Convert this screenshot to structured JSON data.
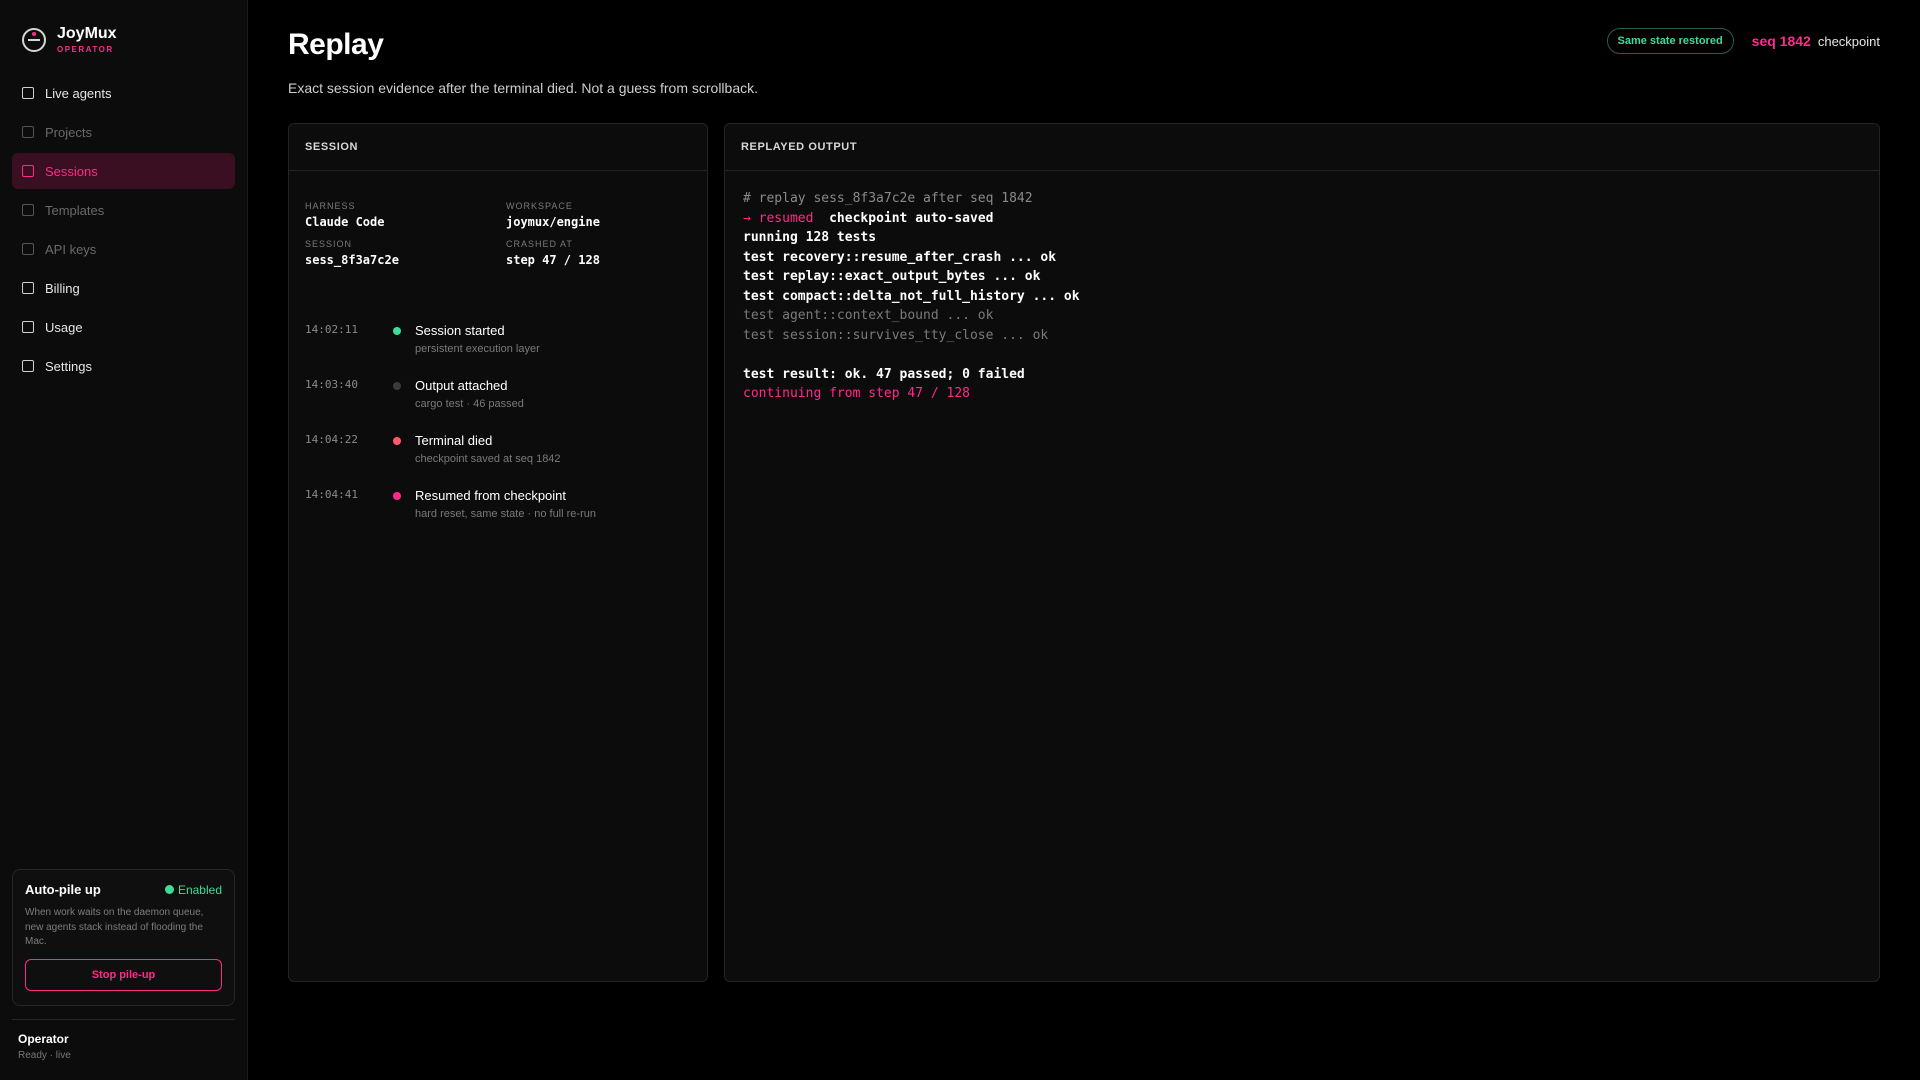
{
  "brand": {
    "name": "JoyMux",
    "subtitle": "OPERATOR"
  },
  "nav": [
    {
      "label": "Live agents",
      "state": "normal"
    },
    {
      "label": "Projects",
      "state": "dim"
    },
    {
      "label": "Sessions",
      "state": "active"
    },
    {
      "label": "Templates",
      "state": "dim"
    },
    {
      "label": "API keys",
      "state": "dim"
    },
    {
      "label": "Billing",
      "state": "normal"
    },
    {
      "label": "Usage",
      "state": "normal"
    },
    {
      "label": "Settings",
      "state": "normal"
    }
  ],
  "pile_up": {
    "title": "Auto-pile up",
    "status": "Enabled",
    "description": "When work waits on the daemon queue, new agents stack instead of flooding the Mac.",
    "button": "Stop pile-up"
  },
  "operator": {
    "name": "Operator",
    "status": "Ready · live"
  },
  "header": {
    "title": "Replay",
    "subtitle": "Exact session evidence after the terminal died. Not a guess from scrollback.",
    "badge": "Same state restored",
    "seq": "seq 1842",
    "seq_label": "checkpoint"
  },
  "session_panel": {
    "heading": "SESSION",
    "meta": {
      "harness_label": "HARNESS",
      "harness_value": "Claude Code",
      "workspace_label": "WORKSPACE",
      "workspace_value": "joymux/engine",
      "session_label": "SESSION",
      "session_value": "sess_8f3a7c2e",
      "crashed_label": "CRASHED AT",
      "crashed_value": "step 47 / 128"
    },
    "timeline": [
      {
        "time": "14:02:11",
        "title": "Session started",
        "desc": "persistent execution layer",
        "color": "#3ddc97"
      },
      {
        "time": "14:03:40",
        "title": "Output attached",
        "desc": "cargo test · 46 passed",
        "color": "#3a3a3a"
      },
      {
        "time": "14:04:22",
        "title": "Terminal died",
        "desc": "checkpoint saved at seq 1842",
        "color": "#ff5a6a"
      },
      {
        "time": "14:04:41",
        "title": "Resumed from checkpoint",
        "desc": "hard reset, same state · no full re-run",
        "color": "#ff2a8a"
      }
    ]
  },
  "output_panel": {
    "heading": "REPLAYED OUTPUT",
    "lines": {
      "l1": "# replay sess_8f3a7c2e after seq 1842",
      "l2_prefix": "→ resumed",
      "l2_rest": "  checkpoint auto-saved",
      "l3": "running 128 tests",
      "l4": "test recovery::resume_after_crash ... ok",
      "l5": "test replay::exact_output_bytes ... ok",
      "l6": "test compact::delta_not_full_history ... ok",
      "l7": "test agent::context_bound ... ok",
      "l8": "test session::survives_tty_close ... ok",
      "l9": "test result: ok. 47 passed; 0 failed",
      "l10": "continuing from step 47 / 128"
    }
  }
}
